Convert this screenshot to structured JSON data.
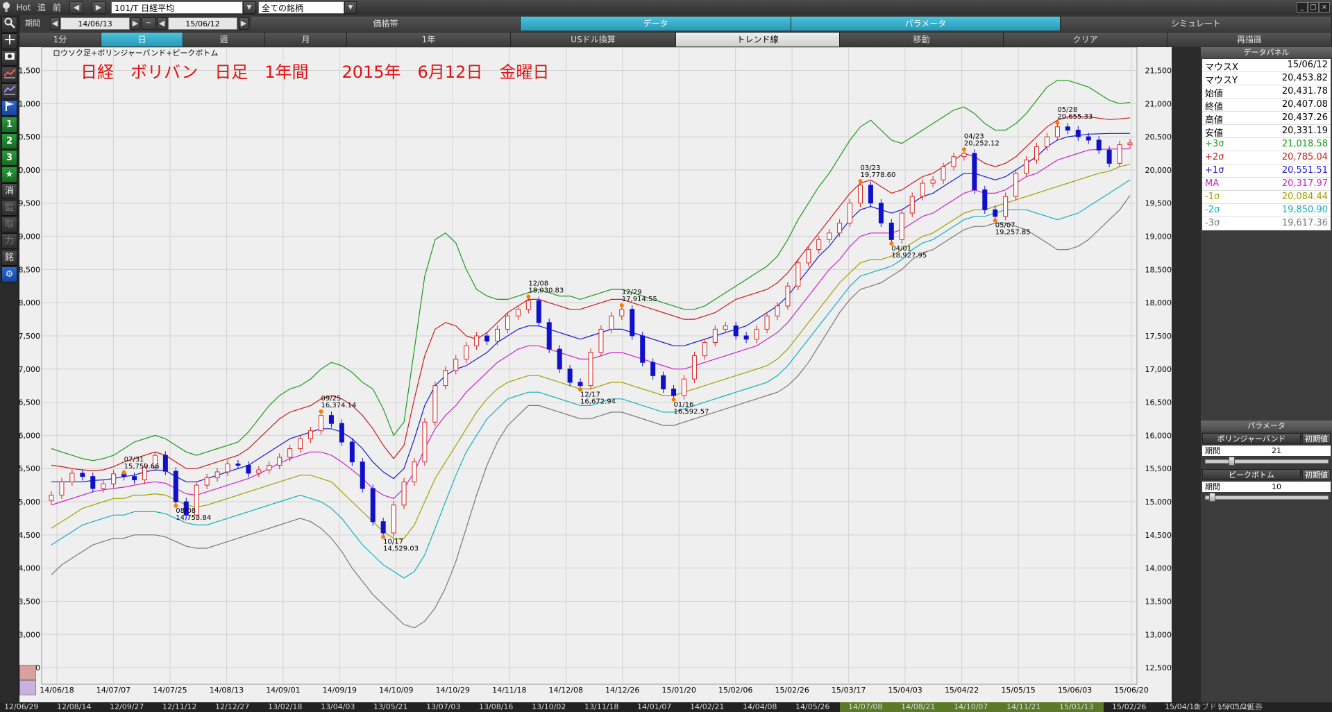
{
  "topbar": {
    "hot": "Hot",
    "tsui": "追",
    "mae": "前",
    "symbol": "101/T 日経平均",
    "filter": "全ての銘柄"
  },
  "row2": {
    "period_label": "期間",
    "from_date": "14/06/13",
    "tilde": "~",
    "to_date": "15/06/12",
    "tabs": [
      "価格帯",
      "データ",
      "パラメータ",
      "シミュレート"
    ]
  },
  "row3": {
    "items": [
      "1分",
      "日",
      "週",
      "月",
      "1年",
      "USドル換算",
      "トレンド線",
      "移動",
      "クリア",
      "再描画"
    ]
  },
  "lefttools": {
    "shou": "消",
    "kan": "監",
    "tori": "取",
    "chikara": "力",
    "mei": "銘",
    "n1": "1",
    "n2": "2",
    "n3": "3"
  },
  "chart": {
    "indicator_label": "ロウソク足+ボリンジャーバンド+ピークボトム",
    "title_overlay": "日経　ボリバン　日足　1年間　　2015年　6月12日　金曜日",
    "annotations": [
      {
        "date": "07/31",
        "value": "15,759.66"
      },
      {
        "date": "08/08",
        "value": "14,753.84"
      },
      {
        "date": "09/25",
        "value": "16,374.14"
      },
      {
        "date": "10/17",
        "value": "14,529.03"
      },
      {
        "date": "12/08",
        "value": "18,030.83"
      },
      {
        "date": "12/17",
        "value": "16,672.94"
      },
      {
        "date": "12/29",
        "value": "17,914.55"
      },
      {
        "date": "01/16",
        "value": "16,592.57"
      },
      {
        "date": "03/23",
        "value": "19,778.60"
      },
      {
        "date": "04/01",
        "value": "18,927.95"
      },
      {
        "date": "04/23",
        "value": "20,252.12"
      },
      {
        "date": "05/07",
        "value": "19,257.85"
      },
      {
        "date": "05/28",
        "value": "20,655.33"
      }
    ]
  },
  "chart_data": {
    "type": "line",
    "title": "日経　ボリバン　日足　1年間　　2015年　6月12日　金曜日",
    "subtitle": "ロウソク足+ボリンジャーバンド+ピークボトム",
    "y_ticks": [
      "12,500",
      "13,000",
      "13,500",
      "14,000",
      "14,500",
      "15,000",
      "15,500",
      "16,000",
      "16,500",
      "17,000",
      "17,500",
      "18,000",
      "18,500",
      "19,000",
      "19,500",
      "20,000",
      "20,500",
      "21,000",
      "21,500"
    ],
    "x_ticks": [
      "14/06/18",
      "14/07/07",
      "14/07/25",
      "14/08/13",
      "14/09/01",
      "14/09/19",
      "14/10/09",
      "14/10/29",
      "14/11/18",
      "14/12/08",
      "14/12/26",
      "15/01/20",
      "15/02/06",
      "15/02/26",
      "15/03/17",
      "15/04/03",
      "15/04/22",
      "15/05/15",
      "15/06/03",
      "15/06/20"
    ],
    "ylim": [
      12250,
      21850
    ],
    "close_series": [
      15100,
      15300,
      15430,
      15380,
      15200,
      15270,
      15420,
      15380,
      15330,
      15520,
      15700,
      15460,
      15000,
      14800,
      15250,
      15360,
      15450,
      15570,
      15550,
      15430,
      15480,
      15550,
      15670,
      15800,
      15950,
      16070,
      16300,
      16180,
      15900,
      15600,
      15200,
      14700,
      14530,
      14950,
      15300,
      15600,
      16200,
      16750,
      16980,
      17150,
      17350,
      17500,
      17420,
      17600,
      17800,
      17900,
      18030,
      17700,
      17300,
      17000,
      16800,
      16750,
      17250,
      17600,
      17800,
      17900,
      17500,
      17100,
      16900,
      16700,
      16600,
      16850,
      17200,
      17400,
      17600,
      17650,
      17500,
      17450,
      17600,
      17800,
      17950,
      18250,
      18600,
      18800,
      18950,
      19050,
      19200,
      19500,
      19770,
      19500,
      19200,
      18950,
      19350,
      19600,
      19800,
      19850,
      20050,
      20200,
      20250,
      19700,
      19400,
      19300,
      19600,
      19950,
      20150,
      20350,
      20500,
      20650,
      20600,
      20500,
      20450,
      20300,
      20100,
      20380,
      20407
    ],
    "series": [
      {
        "name": "+3σ",
        "color": "#1a9a1a",
        "values": [
          15800,
          15750,
          15700,
          15650,
          15620,
          15650,
          15700,
          15800,
          15900,
          15950,
          16000,
          15950,
          15850,
          15750,
          15700,
          15750,
          15800,
          15850,
          15900,
          16050,
          16250,
          16450,
          16600,
          16700,
          16750,
          16850,
          17000,
          17100,
          17050,
          16950,
          16800,
          16700,
          16400,
          16000,
          16200,
          17300,
          18400,
          18950,
          19050,
          18900,
          18500,
          18200,
          18100,
          18050,
          18050,
          18100,
          18150,
          18200,
          18150,
          18100,
          18100,
          18050,
          18100,
          18150,
          18200,
          18200,
          18150,
          18100,
          18050,
          18000,
          17950,
          17900,
          17900,
          17950,
          18050,
          18150,
          18250,
          18350,
          18450,
          18550,
          18700,
          18950,
          19250,
          19500,
          19750,
          19950,
          20200,
          20450,
          20650,
          20750,
          20600,
          20450,
          20400,
          20500,
          20600,
          20700,
          20800,
          20900,
          20950,
          20850,
          20700,
          20600,
          20600,
          20700,
          20850,
          21050,
          21250,
          21350,
          21350,
          21300,
          21250,
          21150,
          21050,
          21000,
          21019
        ]
      },
      {
        "name": "+2σ",
        "color": "#cc1a1a",
        "values": [
          15550,
          15530,
          15500,
          15480,
          15470,
          15480,
          15530,
          15600,
          15650,
          15700,
          15750,
          15700,
          15600,
          15500,
          15500,
          15550,
          15600,
          15650,
          15700,
          15800,
          15950,
          16100,
          16250,
          16350,
          16400,
          16450,
          16550,
          16600,
          16550,
          16450,
          16300,
          16100,
          15850,
          15650,
          15850,
          16550,
          17200,
          17600,
          17700,
          17650,
          17500,
          17450,
          17550,
          17700,
          17850,
          17950,
          18050,
          18050,
          18000,
          17950,
          17900,
          17900,
          17950,
          18000,
          18050,
          18050,
          18000,
          17950,
          17900,
          17850,
          17800,
          17750,
          17750,
          17800,
          17850,
          17950,
          18050,
          18100,
          18150,
          18200,
          18300,
          18450,
          18650,
          18850,
          19050,
          19250,
          19450,
          19650,
          19800,
          19850,
          19750,
          19650,
          19700,
          19800,
          19900,
          19950,
          20050,
          20150,
          20250,
          20200,
          20100,
          20050,
          20100,
          20200,
          20350,
          20500,
          20650,
          20750,
          20800,
          20800,
          20800,
          20780,
          20760,
          20770,
          20785
        ]
      },
      {
        "name": "+1σ",
        "color": "#1a1acc",
        "values": [
          15300,
          15300,
          15300,
          15300,
          15320,
          15330,
          15350,
          15380,
          15400,
          15450,
          15480,
          15470,
          15380,
          15300,
          15300,
          15350,
          15400,
          15450,
          15500,
          15550,
          15650,
          15750,
          15850,
          15950,
          16000,
          16050,
          16100,
          16100,
          16050,
          15950,
          15800,
          15600,
          15450,
          15350,
          15500,
          15950,
          16450,
          16750,
          16900,
          17000,
          17050,
          17150,
          17250,
          17400,
          17500,
          17600,
          17650,
          17650,
          17600,
          17550,
          17500,
          17450,
          17500,
          17550,
          17600,
          17600,
          17550,
          17500,
          17450,
          17400,
          17350,
          17350,
          17400,
          17450,
          17500,
          17550,
          17600,
          17650,
          17750,
          17850,
          17950,
          18100,
          18300,
          18500,
          18700,
          18850,
          19050,
          19250,
          19400,
          19450,
          19400,
          19350,
          19400,
          19500,
          19600,
          19650,
          19750,
          19850,
          19950,
          19950,
          19900,
          19850,
          19900,
          20000,
          20100,
          20200,
          20350,
          20450,
          20500,
          20520,
          20540,
          20545,
          20550,
          20550,
          20552
        ]
      },
      {
        "name": "MA",
        "color": "#cc22cc",
        "values": [
          14950,
          15000,
          15050,
          15100,
          15150,
          15180,
          15200,
          15220,
          15250,
          15280,
          15300,
          15280,
          15200,
          15120,
          15100,
          15150,
          15200,
          15250,
          15300,
          15350,
          15420,
          15500,
          15580,
          15650,
          15700,
          15750,
          15750,
          15700,
          15600,
          15480,
          15350,
          15200,
          15100,
          15050,
          15200,
          15450,
          15800,
          16100,
          16300,
          16450,
          16650,
          16800,
          16950,
          17100,
          17200,
          17300,
          17350,
          17350,
          17300,
          17250,
          17200,
          17150,
          17150,
          17200,
          17250,
          17250,
          17200,
          17150,
          17100,
          17050,
          17000,
          17000,
          17050,
          17100,
          17150,
          17200,
          17250,
          17300,
          17350,
          17450,
          17550,
          17700,
          17900,
          18100,
          18300,
          18500,
          18650,
          18850,
          19000,
          19050,
          19050,
          19050,
          19100,
          19200,
          19300,
          19350,
          19450,
          19550,
          19650,
          19700,
          19650,
          19650,
          19700,
          19800,
          19900,
          19950,
          20050,
          20150,
          20200,
          20250,
          20300,
          20310,
          20315,
          20317,
          20318
        ]
      },
      {
        "name": "-1σ",
        "color": "#a0a000",
        "values": [
          14600,
          14700,
          14800,
          14900,
          14950,
          15000,
          15050,
          15050,
          15100,
          15100,
          15120,
          15100,
          15030,
          14950,
          14920,
          14950,
          15000,
          15050,
          15100,
          15150,
          15200,
          15250,
          15300,
          15350,
          15400,
          15400,
          15350,
          15300,
          15150,
          15000,
          14850,
          14700,
          14550,
          14450,
          14450,
          14650,
          15000,
          15350,
          15600,
          15850,
          16100,
          16350,
          16550,
          16700,
          16800,
          16850,
          16900,
          16900,
          16850,
          16800,
          16750,
          16700,
          16700,
          16750,
          16800,
          16800,
          16750,
          16700,
          16650,
          16600,
          16600,
          16650,
          16700,
          16750,
          16800,
          16850,
          16900,
          16950,
          17000,
          17050,
          17150,
          17300,
          17500,
          17700,
          17900,
          18100,
          18300,
          18450,
          18600,
          18650,
          18650,
          18700,
          18800,
          18900,
          19000,
          19050,
          19150,
          19250,
          19350,
          19400,
          19400,
          19450,
          19500,
          19550,
          19600,
          19650,
          19700,
          19750,
          19800,
          19850,
          19900,
          19950,
          19980,
          20050,
          20084
        ]
      },
      {
        "name": "-2σ",
        "color": "#10b0c0",
        "values": [
          14350,
          14450,
          14550,
          14650,
          14700,
          14750,
          14800,
          14800,
          14850,
          14850,
          14850,
          14820,
          14750,
          14680,
          14650,
          14650,
          14700,
          14750,
          14800,
          14850,
          14900,
          14950,
          15000,
          15050,
          15100,
          15050,
          15000,
          14900,
          14750,
          14550,
          14350,
          14200,
          14050,
          13950,
          13850,
          13950,
          14200,
          14600,
          15000,
          15400,
          15750,
          16000,
          16250,
          16400,
          16550,
          16600,
          16650,
          16650,
          16600,
          16550,
          16500,
          16450,
          16450,
          16500,
          16550,
          16550,
          16500,
          16450,
          16400,
          16350,
          16350,
          16400,
          16450,
          16500,
          16550,
          16600,
          16650,
          16700,
          16750,
          16800,
          16900,
          17050,
          17250,
          17450,
          17650,
          17850,
          18050,
          18250,
          18400,
          18450,
          18500,
          18550,
          18650,
          18800,
          18900,
          18950,
          19050,
          19150,
          19250,
          19300,
          19300,
          19350,
          19400,
          19400,
          19400,
          19350,
          19300,
          19250,
          19300,
          19350,
          19450,
          19550,
          19650,
          19750,
          19851
        ]
      },
      {
        "name": "-3σ",
        "color": "#777777",
        "values": [
          13900,
          14050,
          14150,
          14250,
          14350,
          14400,
          14450,
          14450,
          14500,
          14500,
          14500,
          14470,
          14400,
          14330,
          14300,
          14300,
          14350,
          14400,
          14450,
          14500,
          14550,
          14600,
          14650,
          14700,
          14750,
          14700,
          14600,
          14450,
          14250,
          14000,
          13800,
          13600,
          13450,
          13300,
          13150,
          13100,
          13200,
          13400,
          13700,
          14100,
          14600,
          15100,
          15550,
          15900,
          16150,
          16300,
          16450,
          16450,
          16400,
          16350,
          16300,
          16250,
          16250,
          16300,
          16350,
          16350,
          16300,
          16250,
          16200,
          16150,
          16150,
          16200,
          16250,
          16300,
          16350,
          16400,
          16450,
          16500,
          16550,
          16600,
          16650,
          16750,
          16900,
          17100,
          17350,
          17600,
          17850,
          18050,
          18200,
          18250,
          18300,
          18400,
          18500,
          18650,
          18750,
          18800,
          18900,
          19000,
          19100,
          19150,
          19150,
          19200,
          19200,
          19150,
          19100,
          19000,
          18900,
          18800,
          18800,
          18850,
          18950,
          19100,
          19250,
          19400,
          19617
        ]
      }
    ]
  },
  "datapanel": {
    "title": "データパネル",
    "rows": [
      {
        "k": "マウスX",
        "v": "15/06/12",
        "color": "#000000"
      },
      {
        "k": "マウスY",
        "v": "20,453.82",
        "color": "#000000"
      },
      {
        "k": "始値",
        "v": "20,431.78",
        "color": "#000000"
      },
      {
        "k": "終値",
        "v": "20,407.08",
        "color": "#000000"
      },
      {
        "k": "高値",
        "v": "20,437.26",
        "color": "#000000"
      },
      {
        "k": "安値",
        "v": "20,331.19",
        "color": "#000000"
      },
      {
        "k": "+3σ",
        "v": "21,018.58",
        "color": "#1a9a1a"
      },
      {
        "k": "+2σ",
        "v": "20,785.04",
        "color": "#cc1a1a"
      },
      {
        "k": "+1σ",
        "v": "20,551.51",
        "color": "#1a1acc"
      },
      {
        "k": "MA",
        "v": "20,317.97",
        "color": "#cc22cc"
      },
      {
        "k": "-1σ",
        "v": "20,084.44",
        "color": "#a0a000"
      },
      {
        "k": "-2σ",
        "v": "19,850.90",
        "color": "#10b0c0"
      },
      {
        "k": "-3σ",
        "v": "19,617.36",
        "color": "#777777"
      }
    ]
  },
  "params": {
    "title": "パラメータ",
    "bb_label": "ボリンジャーバンド",
    "bb_reset": "初期値",
    "bb_period_label": "期間",
    "bb_period": "21",
    "pb_label": "ピークボトム",
    "pb_reset": "初期値",
    "pb_period_label": "期間",
    "pb_period": "10"
  },
  "bottombar": {
    "dates": [
      "12/06/29",
      "12/08/14",
      "12/09/27",
      "12/11/12",
      "12/12/27",
      "13/02/18",
      "13/04/03",
      "13/05/21",
      "13/07/03",
      "13/08/16",
      "13/10/02",
      "13/11/18",
      "14/01/07",
      "14/02/21",
      "14/04/08",
      "14/05/26",
      "14/07/08",
      "14/08/21",
      "14/10/07",
      "14/11/21",
      "15/01/13",
      "15/02/26",
      "15/04/10",
      "15/05/29"
    ],
    "brand": "カブドットコム証券"
  }
}
